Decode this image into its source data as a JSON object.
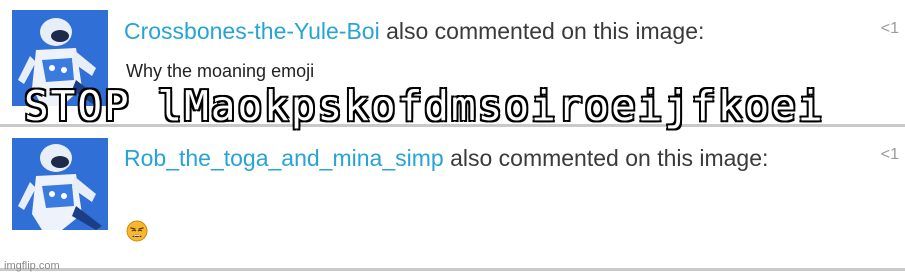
{
  "comments": [
    {
      "username": "Crossbones-the-Yule-Boi",
      "action": " also commented on this image:",
      "time": "<1",
      "text": "Why the moaning emoji"
    },
    {
      "username": "Rob_the_toga_and_mina_simp",
      "action": " also commented on this image:",
      "time": "<1",
      "emoji": "weary-face-emoji"
    }
  ],
  "overlay": {
    "text": "STOP lMaokpskofdmsoiroeijfkoei"
  },
  "watermark": {
    "text": "imgflip.com"
  },
  "colors": {
    "username": "#27a3d6",
    "text": "#3a3a3a",
    "avatar_bg": "#2f6fd6",
    "divider": "#c9c9c9"
  }
}
